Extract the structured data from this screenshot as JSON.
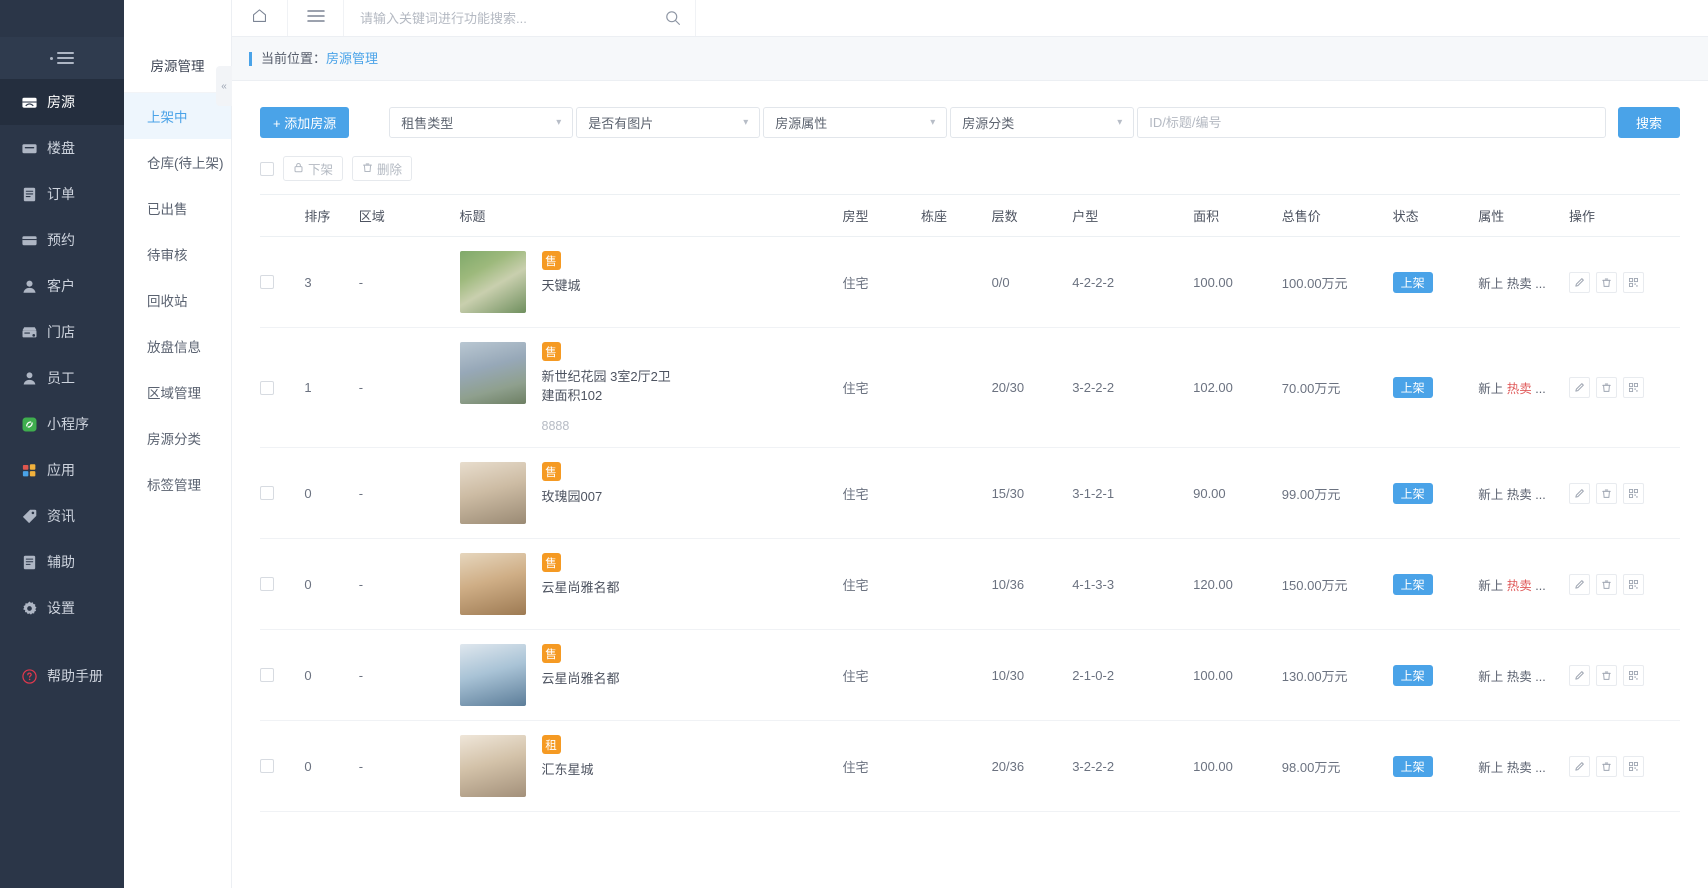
{
  "sidebar": {
    "toggle_icon": "collapse-menu-icon",
    "items": [
      {
        "label": "房源",
        "icon": "house-icon",
        "active": true
      },
      {
        "label": "楼盘",
        "icon": "building-icon",
        "active": false
      },
      {
        "label": "订单",
        "icon": "order-icon",
        "active": false
      },
      {
        "label": "预约",
        "icon": "calendar-icon",
        "active": false
      },
      {
        "label": "客户",
        "icon": "user-icon",
        "active": false
      },
      {
        "label": "门店",
        "icon": "shop-icon",
        "active": false
      },
      {
        "label": "员工",
        "icon": "staff-icon",
        "active": false
      },
      {
        "label": "小程序",
        "icon": "miniapp-icon",
        "active": false
      },
      {
        "label": "应用",
        "icon": "apps-icon",
        "active": false
      },
      {
        "label": "资讯",
        "icon": "news-tag-icon",
        "active": false
      },
      {
        "label": "辅助",
        "icon": "assist-icon",
        "active": false
      },
      {
        "label": "设置",
        "icon": "gear-icon",
        "active": false
      }
    ],
    "help": {
      "label": "帮助手册",
      "icon": "question-circle-icon"
    }
  },
  "submenu": {
    "title": "房源管理",
    "collapse_icon": "chevron-left-icon",
    "items": [
      {
        "label": "上架中",
        "active": true
      },
      {
        "label": "仓库(待上架)",
        "active": false
      },
      {
        "label": "已出售",
        "active": false
      },
      {
        "label": "待审核",
        "active": false
      },
      {
        "label": "回收站",
        "active": false
      },
      {
        "label": "放盘信息",
        "active": false
      },
      {
        "label": "区域管理",
        "active": false
      },
      {
        "label": "房源分类",
        "active": false
      },
      {
        "label": "标签管理",
        "active": false
      }
    ]
  },
  "topbar": {
    "home_icon": "home-icon",
    "menu_icon": "hamburger-menu-icon",
    "search_placeholder": "请输入关键词进行功能搜索...",
    "search_value": "",
    "search_icon": "search-icon"
  },
  "breadcrumb": {
    "prefix": "当前位置：",
    "current": "房源管理"
  },
  "filters": {
    "add_button": "+ 添加房源",
    "selects": [
      {
        "value": "租售类型"
      },
      {
        "value": "是否有图片"
      },
      {
        "value": "房源属性"
      },
      {
        "value": "房源分类"
      }
    ],
    "keyword_placeholder": "ID/标题/编号",
    "keyword_value": "",
    "search_button": "搜索"
  },
  "batch_toolbar": {
    "unlist_button": "下架",
    "unlist_icon": "lock-icon",
    "delete_button": "删除",
    "delete_icon": "trash-icon"
  },
  "table": {
    "columns": [
      "排序",
      "区域",
      "标题",
      "房型",
      "栋座",
      "层数",
      "户型",
      "面积",
      "总售价",
      "状态",
      "属性",
      "操作"
    ],
    "rows": [
      {
        "sort": "3",
        "area": "-",
        "badge": "售",
        "title": "天键城",
        "title_line2": "",
        "sub": "",
        "thumb": "aerial-housing-estate",
        "house_type": "住宅",
        "building": "",
        "floor": "0/0",
        "unit": "4-2-2-2",
        "size": "100.00",
        "price": "100.00万元",
        "status": "上架",
        "attr_new": "新上",
        "attr_hot": "热卖",
        "attr_more": "...",
        "hot_red": false
      },
      {
        "sort": "1",
        "area": "-",
        "badge": "售",
        "title": "新世纪花园 3室2厅2卫",
        "title_line2": "建面积102",
        "sub": "8888",
        "thumb": "residential-towers",
        "house_type": "住宅",
        "building": "",
        "floor": "20/30",
        "unit": "3-2-2-2",
        "size": "102.00",
        "price": "70.00万元",
        "status": "上架",
        "attr_new": "新上",
        "attr_hot": "热卖",
        "attr_more": "...",
        "hot_red": true
      },
      {
        "sort": "0",
        "area": "-",
        "badge": "售",
        "title": "玫瑰园007",
        "title_line2": "",
        "sub": "",
        "thumb": "living-room-interior",
        "house_type": "住宅",
        "building": "",
        "floor": "15/30",
        "unit": "3-1-2-1",
        "size": "90.00",
        "price": "99.00万元",
        "status": "上架",
        "attr_new": "新上",
        "attr_hot": "热卖",
        "attr_more": "...",
        "hot_red": false
      },
      {
        "sort": "0",
        "area": "-",
        "badge": "售",
        "title": "云星尚雅名都",
        "title_line2": "",
        "sub": "",
        "thumb": "warm-living-room",
        "house_type": "住宅",
        "building": "",
        "floor": "10/36",
        "unit": "4-1-3-3",
        "size": "120.00",
        "price": "150.00万元",
        "status": "上架",
        "attr_new": "新上",
        "attr_hot": "热卖",
        "attr_more": "...",
        "hot_red": true
      },
      {
        "sort": "0",
        "area": "-",
        "badge": "售",
        "title": "云星尚雅名都",
        "title_line2": "",
        "sub": "",
        "thumb": "blue-living-room",
        "house_type": "住宅",
        "building": "",
        "floor": "10/30",
        "unit": "2-1-0-2",
        "size": "100.00",
        "price": "130.00万元",
        "status": "上架",
        "attr_new": "新上",
        "attr_hot": "热卖",
        "attr_more": "...",
        "hot_red": false
      },
      {
        "sort": "0",
        "area": "-",
        "badge": "租",
        "title": "汇东星城",
        "title_line2": "",
        "sub": "",
        "thumb": "bright-bedroom",
        "house_type": "住宅",
        "building": "",
        "floor": "20/36",
        "unit": "3-2-2-2",
        "size": "100.00",
        "price": "98.00万元",
        "status": "上架",
        "attr_new": "新上",
        "attr_hot": "热卖",
        "attr_more": "...",
        "hot_red": false
      }
    ],
    "ops": {
      "edit_icon": "pencil-icon",
      "delete_icon": "trash-icon",
      "qr_icon": "qrcode-icon"
    }
  },
  "colors": {
    "accent": "#4aa3e8",
    "sidebar_bg": "#2b3648",
    "sidebar_active": "#242e3e",
    "badge_sale": "#f59a23",
    "hot_red": "#e05b5b",
    "help_red": "#e2384d"
  }
}
